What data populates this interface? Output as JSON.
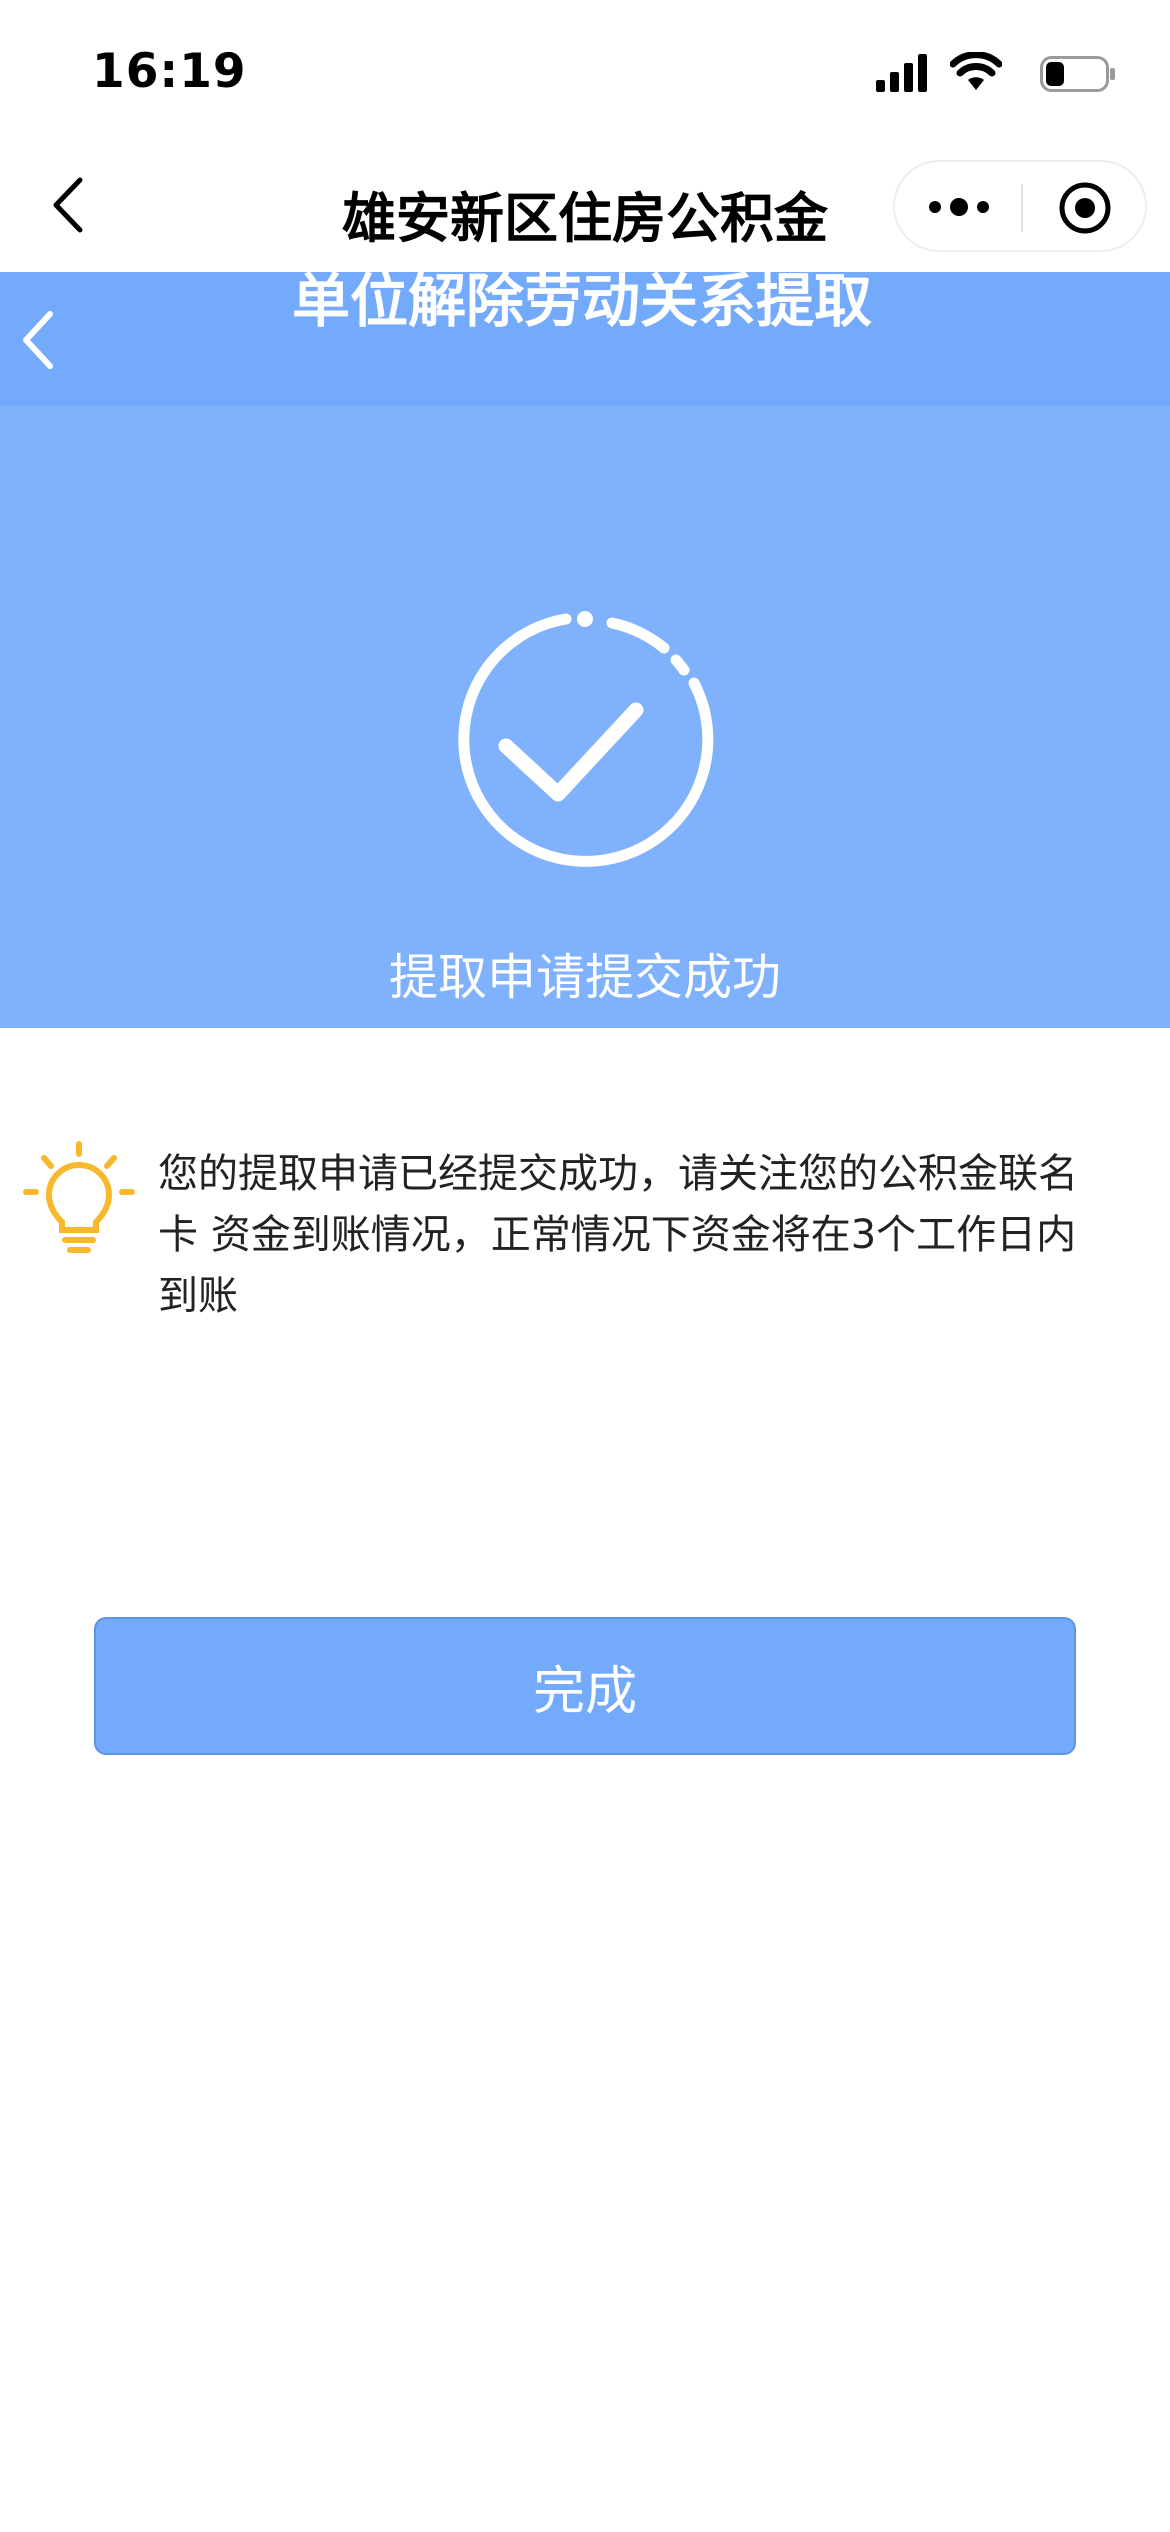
{
  "status_bar": {
    "time": "16:19",
    "icons": [
      "cellular-signal-icon",
      "wifi-icon",
      "battery-icon"
    ]
  },
  "mini_program": {
    "title": "雄安新区住房公积金",
    "back_icon": "chevron-left-icon",
    "more_icon": "more-dots-icon",
    "close_icon": "target-close-icon"
  },
  "page": {
    "title": "单位解除劳动关系提取",
    "back_icon": "chevron-left-icon",
    "header_color": "#74aafb"
  },
  "result": {
    "icon": "success-check-circle-icon",
    "status_text": "提取申请提交成功",
    "panel_color": "#80b1fd"
  },
  "tip": {
    "icon": "lightbulb-icon",
    "icon_color": "#f7b92b",
    "message": "您的提取申请已经提交成功，请关注您的公积金联名卡 资金到账情况，正常情况下资金将在3个工作日内到账"
  },
  "actions": {
    "done_label": "完成",
    "button_color": "#74aafb"
  }
}
